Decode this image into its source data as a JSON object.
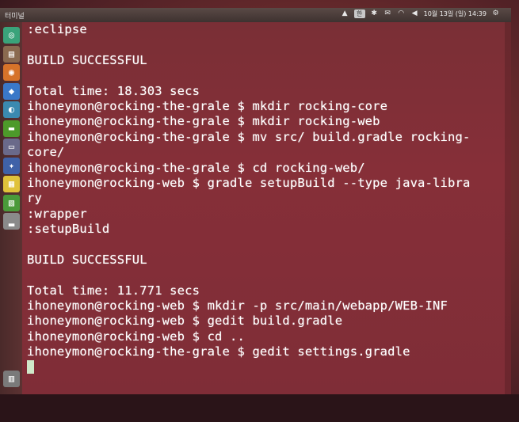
{
  "top_panel": {
    "window_title": "터미널",
    "tray": {
      "ime": "한",
      "clock": "10월 13일 (일) 14:39"
    }
  },
  "launcher": {
    "items": [
      {
        "name": "dash-icon",
        "glyph": "◎",
        "color": "#3aa37a"
      },
      {
        "name": "files-icon",
        "glyph": "▤",
        "color": "#8a6a50"
      },
      {
        "name": "firefox-icon",
        "glyph": "◉",
        "color": "#d6732a"
      },
      {
        "name": "browser-icon",
        "glyph": "◆",
        "color": "#3a78c8"
      },
      {
        "name": "eclipse-icon",
        "glyph": "◐",
        "color": "#3b8ab0"
      },
      {
        "name": "terminal-icon",
        "glyph": "▬",
        "color": "#4d9a2a"
      },
      {
        "name": "monitor-icon",
        "glyph": "▭",
        "color": "#6a6a8a"
      },
      {
        "name": "software-icon",
        "glyph": "✦",
        "color": "#3f62a8"
      },
      {
        "name": "document-icon",
        "glyph": "▦",
        "color": "#e0c23a"
      },
      {
        "name": "spreadsheet-icon",
        "glyph": "▧",
        "color": "#4a9a3a"
      },
      {
        "name": "disk-icon",
        "glyph": "▂",
        "color": "#8a8a8a"
      }
    ]
  },
  "terminal": {
    "lines": [
      ":eclipse",
      "",
      "BUILD SUCCESSFUL",
      "",
      "Total time: 18.303 secs",
      "ihoneymon@rocking-the-grale $ mkdir rocking-core",
      "ihoneymon@rocking-the-grale $ mkdir rocking-web",
      "ihoneymon@rocking-the-grale $ mv src/ build.gradle rocking-",
      "core/",
      "ihoneymon@rocking-the-grale $ cd rocking-web/",
      "ihoneymon@rocking-web $ gradle setupBuild --type java-libra",
      "ry",
      ":wrapper",
      ":setupBuild",
      "",
      "BUILD SUCCESSFUL",
      "",
      "Total time: 11.771 secs",
      "ihoneymon@rocking-web $ mkdir -p src/main/webapp/WEB-INF",
      "ihoneymon@rocking-web $ gedit build.gradle",
      "ihoneymon@rocking-web $ cd ..",
      "ihoneymon@rocking-the-grale $ gedit settings.gradle"
    ]
  }
}
